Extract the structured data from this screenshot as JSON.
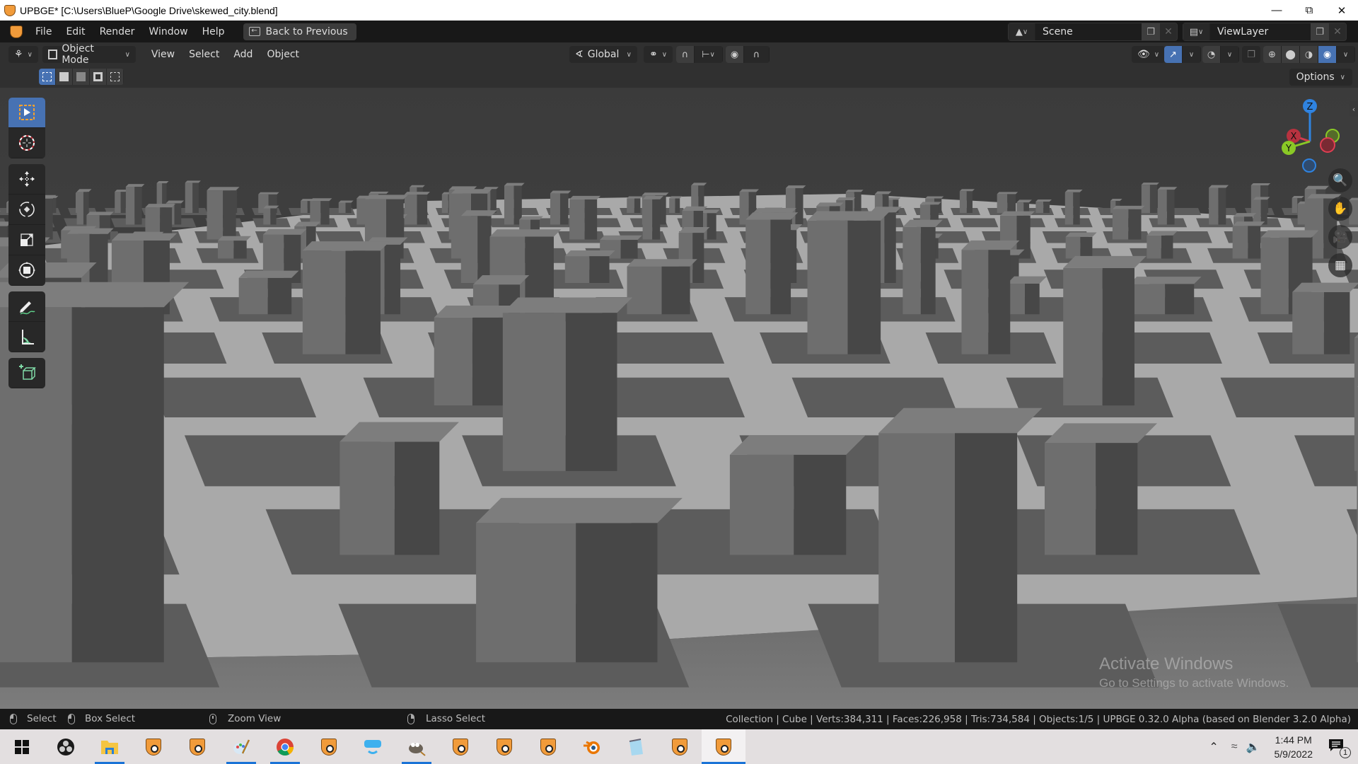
{
  "window": {
    "title": "UPBGE* [C:\\Users\\BlueP\\Google Drive\\skewed_city.blend]",
    "controls": [
      "minimize",
      "restore",
      "close"
    ]
  },
  "topbar": {
    "menus": [
      "File",
      "Edit",
      "Render",
      "Window",
      "Help"
    ],
    "back_button": "Back to Previous",
    "scene": {
      "name": "Scene"
    },
    "view_layer": {
      "name": "ViewLayer"
    }
  },
  "header": {
    "editor_type_icon": "3d-viewport-icon",
    "mode": "Object Mode",
    "menus": [
      "View",
      "Select",
      "Add",
      "Object"
    ],
    "transform_orientation": "Global",
    "pivot_icon": "pivot-icon",
    "snap_icon": "snap-magnet-icon",
    "snap_target_icon": "snap-increment-icon",
    "proportional_icon": "proportional-edit-icon",
    "falloff_icon": "falloff-curve-icon",
    "shading_modes": [
      "wireframe",
      "solid",
      "material-preview",
      "rendered"
    ],
    "active_shading": "rendered"
  },
  "subheader": {
    "select_modes": [
      "set",
      "extend",
      "subtract",
      "invert",
      "intersect"
    ],
    "active_select_mode": "set",
    "options_label": "Options"
  },
  "tools": [
    {
      "name": "select-box",
      "icon": "select-box-icon",
      "active": true
    },
    {
      "name": "cursor",
      "icon": "cursor-icon",
      "active": false
    },
    {
      "name": "move",
      "icon": "move-icon",
      "active": false
    },
    {
      "name": "rotate",
      "icon": "rotate-icon",
      "active": false
    },
    {
      "name": "scale",
      "icon": "scale-icon",
      "active": false
    },
    {
      "name": "transform",
      "icon": "transform-icon",
      "active": false
    },
    {
      "name": "annotate",
      "icon": "annotate-icon",
      "active": false
    },
    {
      "name": "measure",
      "icon": "measure-icon",
      "active": false
    },
    {
      "name": "add-cube",
      "icon": "add-cube-icon",
      "active": false
    }
  ],
  "gizmo": {
    "axes": [
      "Z",
      "X",
      "Y"
    ],
    "colors": {
      "x": "#d33c4e",
      "y": "#8ac926",
      "z": "#2f83e0"
    }
  },
  "nav_buttons": [
    "zoom-icon",
    "pan-hand-icon",
    "camera-icon",
    "ortho-grid-icon"
  ],
  "watermark": {
    "title": "Activate Windows",
    "subtitle": "Go to Settings to activate Windows."
  },
  "statusbar": {
    "hints": [
      {
        "mouse": "left",
        "label": "Select"
      },
      {
        "mouse": "left-drag",
        "label": "Box Select"
      },
      {
        "mouse": "middle",
        "label": "Zoom View"
      },
      {
        "mouse": "right-drag",
        "label": "Lasso Select"
      }
    ],
    "stats": "Collection | Cube | Verts:384,311 | Faces:226,958 | Tris:734,584 | Objects:1/5 | UPBGE 0.32.0 Alpha (based on Blender 3.2.0 Alpha)"
  },
  "taskbar": {
    "apps": [
      {
        "name": "start",
        "icon": "windows-start-icon"
      },
      {
        "name": "obs",
        "icon": "obs-icon"
      },
      {
        "name": "file-explorer",
        "icon": "folder-icon",
        "open": true
      },
      {
        "name": "upbge-1",
        "icon": "upbge-icon"
      },
      {
        "name": "upbge-2",
        "icon": "upbge-icon"
      },
      {
        "name": "paint",
        "icon": "paint-palette-icon",
        "open": true
      },
      {
        "name": "chrome",
        "icon": "chrome-icon",
        "open": true
      },
      {
        "name": "upbge-3",
        "icon": "upbge-icon"
      },
      {
        "name": "vr",
        "icon": "vr-headset-icon"
      },
      {
        "name": "gimp",
        "icon": "gimp-icon",
        "open": true
      },
      {
        "name": "upbge-4",
        "icon": "upbge-icon"
      },
      {
        "name": "upbge-5",
        "icon": "upbge-icon"
      },
      {
        "name": "upbge-6",
        "icon": "upbge-icon"
      },
      {
        "name": "blender",
        "icon": "blender-icon"
      },
      {
        "name": "notepad",
        "icon": "notepad-icon"
      },
      {
        "name": "upbge-7",
        "icon": "upbge-icon"
      },
      {
        "name": "upbge-8",
        "icon": "upbge-icon",
        "active": true
      }
    ],
    "time": "1:44 PM",
    "date": "5/9/2022",
    "notification_count": "1"
  }
}
